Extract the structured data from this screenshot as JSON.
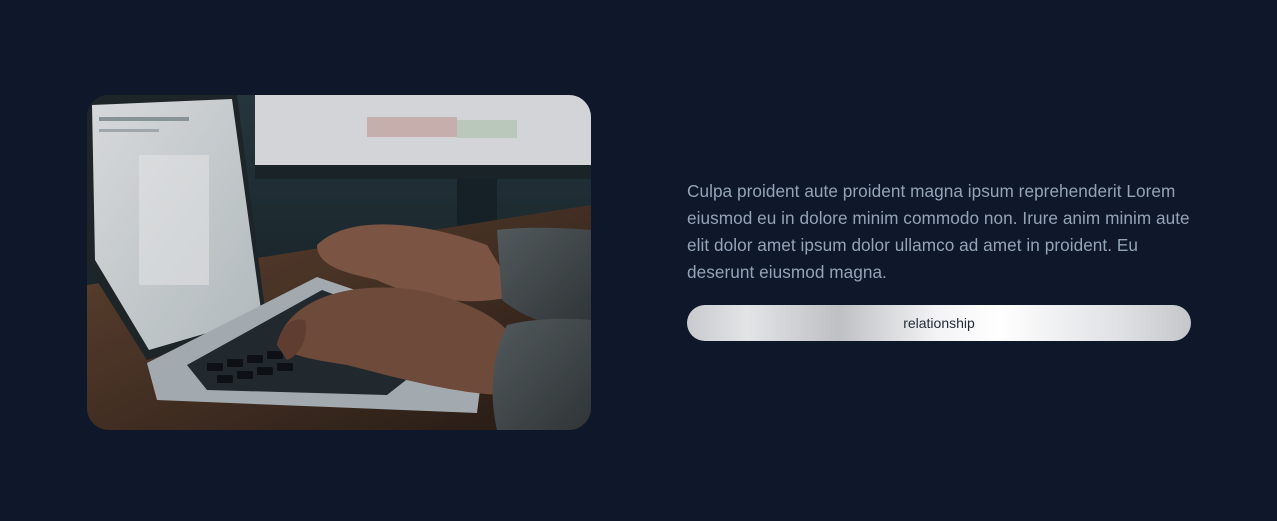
{
  "feature": {
    "image_alt": "Hands typing on a laptop keyboard",
    "body_text": "Culpa proident aute proident magna ipsum reprehenderit Lorem eiusmod eu in dolore minim commodo non. Irure anim minim aute elit dolor amet ipsum dolor ullamco ad amet in proident. Eu deserunt eiusmod magna.",
    "button_label": "relationship"
  },
  "colors": {
    "background": "#0f172a",
    "text": "#94a3b8",
    "button_text": "#1f2937"
  }
}
